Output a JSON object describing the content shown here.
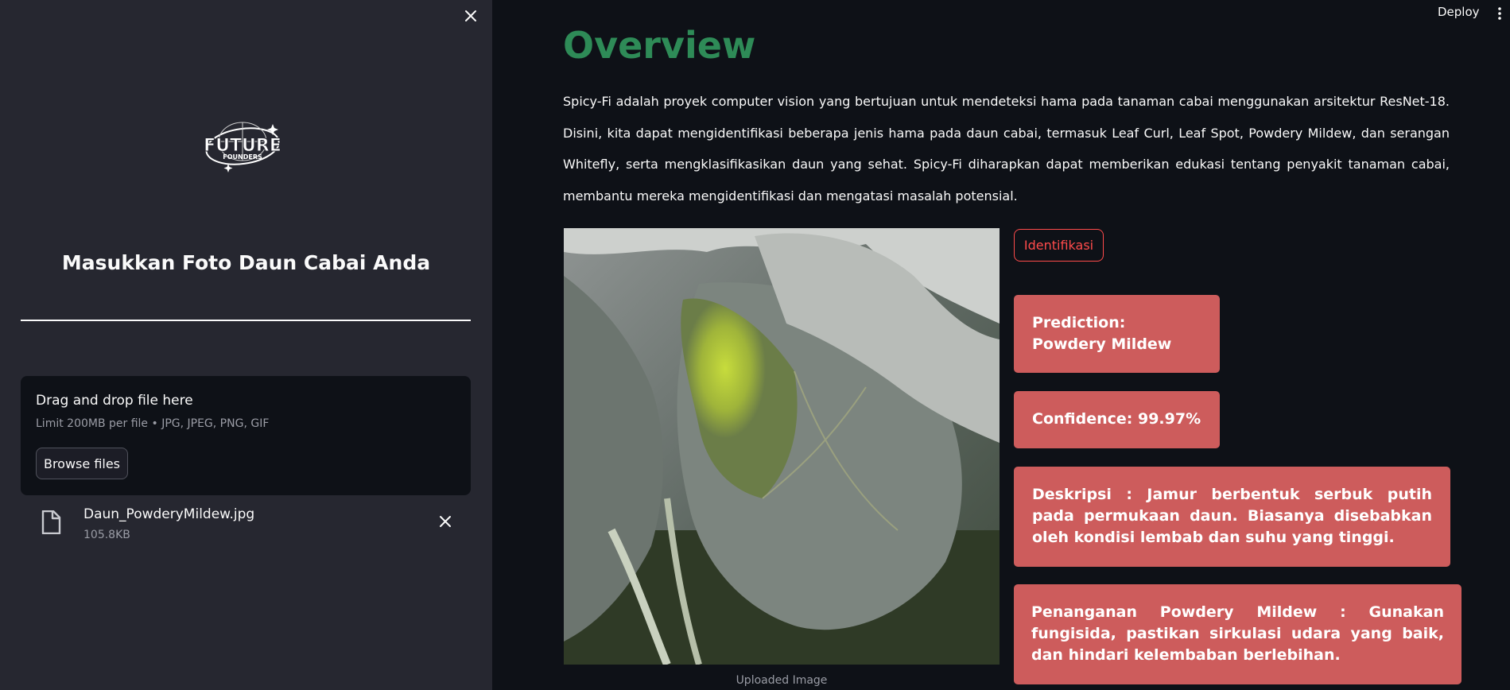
{
  "sidebar": {
    "upload_title": "Masukkan Foto Daun Cabai Anda",
    "logo": {
      "text_main": "FUTURE",
      "text_sub": "FOUNDERS"
    },
    "dropzone": {
      "title": "Drag and drop file here",
      "limit": "Limit 200MB per file • JPG, JPEG, PNG, GIF",
      "browse_label": "Browse files"
    },
    "file": {
      "name": "Daun_PowderyMildew.jpg",
      "size": "105.8KB"
    }
  },
  "header": {
    "deploy_label": "Deploy"
  },
  "main": {
    "title": "Overview",
    "description": "Spicy-Fi adalah proyek computer vision yang bertujuan untuk mendeteksi hama pada tanaman cabai menggunakan arsitektur ResNet-18. Disini, kita dapat mengidentifikasi beberapa jenis hama pada daun cabai, termasuk Leaf Curl, Leaf Spot, Powdery Mildew, dan serangan Whitefly, serta mengklasifikasikan daun yang sehat. Spicy-Fi diharapkan dapat memberikan edukasi tentang penyakit tanaman cabai, membantu mereka mengidentifikasi dan mengatasi masalah potensial.",
    "image_caption": "Uploaded Image",
    "identify_label": "Identifikasi",
    "prediction_text": "Prediction: Powdery Mildew",
    "confidence_text": "Confidence: 99.97%",
    "description_card": "Deskripsi : Jamur berbentuk serbuk putih pada permukaan daun. Biasanya disebabkan oleh kondisi lembab dan suhu yang tinggi.",
    "handling_card": "Penanganan Powdery Mildew : Gunakan fungisida, pastikan sirkulasi udara yang baik, dan hindari kelembaban berlebihan."
  },
  "colors": {
    "sidebar_bg": "#262730",
    "main_bg": "#0e1117",
    "title_green": "#2e8b57",
    "accent_red": "#ff4b4b",
    "card_red": "#cd5c5c"
  },
  "icons": {
    "close": "close-icon",
    "file": "file-icon",
    "remove": "close-icon",
    "menu": "more-vertical-icon"
  }
}
